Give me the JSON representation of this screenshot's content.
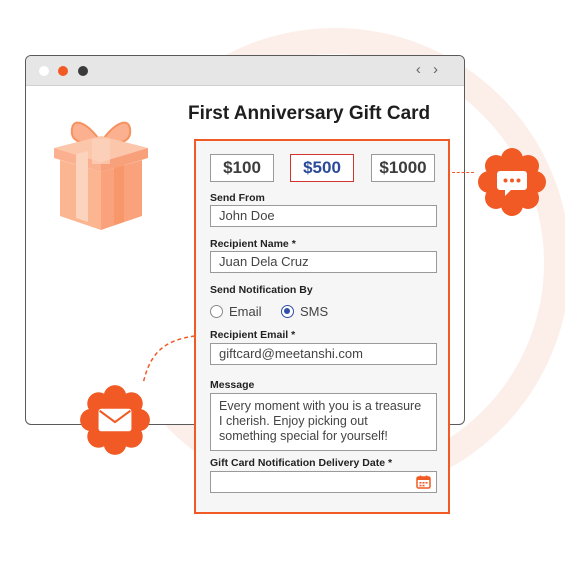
{
  "browser": {
    "nav_arrows": "‹ ›"
  },
  "card": {
    "title": "First Anniversary Gift Card"
  },
  "amounts": [
    "$100",
    "$500",
    "$1000"
  ],
  "selected_amount": "$500",
  "form": {
    "send_from_label": "Send From",
    "send_from_value": "John Doe",
    "recipient_name_label": "Recipient Name *",
    "recipient_name_value": "Juan Dela Cruz",
    "notification_label": "Send Notification By",
    "notification_options": [
      "Email",
      "SMS"
    ],
    "notification_selected": "SMS",
    "recipient_email_label": "Recipient Email *",
    "recipient_email_value": "giftcard@meetanshi.com",
    "message_label": "Message",
    "message_value": "Every moment with you is a treasure I cherish. Enjoy picking out something special for yourself!",
    "delivery_date_label": "Gift Card Notification Delivery Date *",
    "delivery_date_value": ""
  },
  "colors": {
    "accent": "#f15a24",
    "selected_border": "#d0342c",
    "selected_text": "#2c4a9a",
    "gift": "#fbb08f"
  },
  "icons": [
    "gift-box-icon",
    "sms-chat-bubble-icon",
    "email-envelope-icon",
    "calendar-icon"
  ]
}
